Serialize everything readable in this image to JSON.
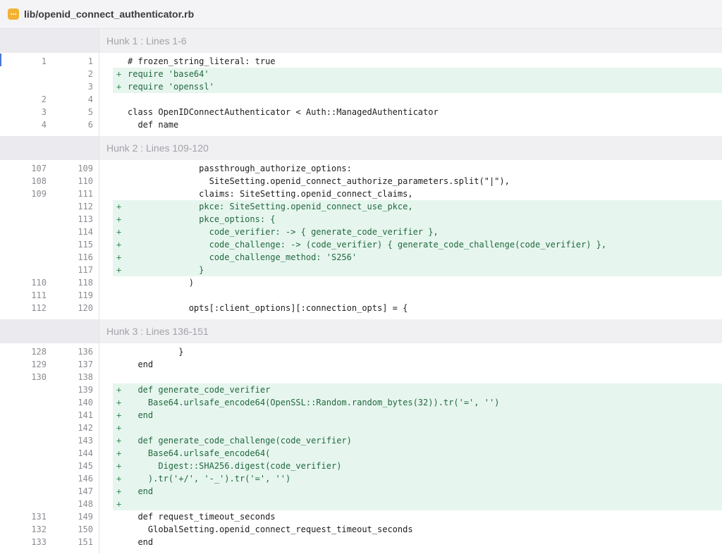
{
  "file": {
    "path": "lib/openid_connect_authenticator.rb",
    "icon": "file-ellipsis-icon"
  },
  "hunks": [
    {
      "label": "Hunk 1 : Lines 1-6",
      "lines": [
        {
          "old": "1",
          "new": "1",
          "type": "context",
          "sign": "",
          "code": "# frozen_string_literal: true"
        },
        {
          "old": "",
          "new": "2",
          "type": "added",
          "sign": "+",
          "code": "require 'base64'"
        },
        {
          "old": "",
          "new": "3",
          "type": "added",
          "sign": "+",
          "code": "require 'openssl'"
        },
        {
          "old": "2",
          "new": "4",
          "type": "context",
          "sign": "",
          "code": ""
        },
        {
          "old": "3",
          "new": "5",
          "type": "context",
          "sign": "",
          "code": "class OpenIDConnectAuthenticator < Auth::ManagedAuthenticator"
        },
        {
          "old": "4",
          "new": "6",
          "type": "context",
          "sign": "",
          "code": "  def name"
        }
      ]
    },
    {
      "label": "Hunk 2 : Lines 109-120",
      "lines": [
        {
          "old": "107",
          "new": "109",
          "type": "context",
          "sign": "",
          "code": "              passthrough_authorize_options:"
        },
        {
          "old": "108",
          "new": "110",
          "type": "context",
          "sign": "",
          "code": "                SiteSetting.openid_connect_authorize_parameters.split(\"|\"),"
        },
        {
          "old": "109",
          "new": "111",
          "type": "context",
          "sign": "",
          "code": "              claims: SiteSetting.openid_connect_claims,"
        },
        {
          "old": "",
          "new": "112",
          "type": "added",
          "sign": "+",
          "code": "              pkce: SiteSetting.openid_connect_use_pkce,"
        },
        {
          "old": "",
          "new": "113",
          "type": "added",
          "sign": "+",
          "code": "              pkce_options: {"
        },
        {
          "old": "",
          "new": "114",
          "type": "added",
          "sign": "+",
          "code": "                code_verifier: -> { generate_code_verifier },"
        },
        {
          "old": "",
          "new": "115",
          "type": "added",
          "sign": "+",
          "code": "                code_challenge: -> (code_verifier) { generate_code_challenge(code_verifier) },"
        },
        {
          "old": "",
          "new": "116",
          "type": "added",
          "sign": "+",
          "code": "                code_challenge_method: 'S256'"
        },
        {
          "old": "",
          "new": "117",
          "type": "added",
          "sign": "+",
          "code": "              }"
        },
        {
          "old": "110",
          "new": "118",
          "type": "context",
          "sign": "",
          "code": "            )"
        },
        {
          "old": "111",
          "new": "119",
          "type": "context",
          "sign": "",
          "code": ""
        },
        {
          "old": "112",
          "new": "120",
          "type": "context",
          "sign": "",
          "code": "            opts[:client_options][:connection_opts] = {"
        }
      ]
    },
    {
      "label": "Hunk 3 : Lines 136-151",
      "lines": [
        {
          "old": "128",
          "new": "136",
          "type": "context",
          "sign": "",
          "code": "          }"
        },
        {
          "old": "129",
          "new": "137",
          "type": "context",
          "sign": "",
          "code": "  end"
        },
        {
          "old": "130",
          "new": "138",
          "type": "context",
          "sign": "",
          "code": ""
        },
        {
          "old": "",
          "new": "139",
          "type": "added",
          "sign": "+",
          "code": "  def generate_code_verifier"
        },
        {
          "old": "",
          "new": "140",
          "type": "added",
          "sign": "+",
          "code": "    Base64.urlsafe_encode64(OpenSSL::Random.random_bytes(32)).tr('=', '')"
        },
        {
          "old": "",
          "new": "141",
          "type": "added",
          "sign": "+",
          "code": "  end"
        },
        {
          "old": "",
          "new": "142",
          "type": "added",
          "sign": "+",
          "code": ""
        },
        {
          "old": "",
          "new": "143",
          "type": "added",
          "sign": "+",
          "code": "  def generate_code_challenge(code_verifier)"
        },
        {
          "old": "",
          "new": "144",
          "type": "added",
          "sign": "+",
          "code": "    Base64.urlsafe_encode64("
        },
        {
          "old": "",
          "new": "145",
          "type": "added",
          "sign": "+",
          "code": "      Digest::SHA256.digest(code_verifier)"
        },
        {
          "old": "",
          "new": "146",
          "type": "added",
          "sign": "+",
          "code": "    ).tr('+/', '-_').tr('=', '')"
        },
        {
          "old": "",
          "new": "147",
          "type": "added",
          "sign": "+",
          "code": "  end"
        },
        {
          "old": "",
          "new": "148",
          "type": "added",
          "sign": "+",
          "code": ""
        },
        {
          "old": "131",
          "new": "149",
          "type": "context",
          "sign": "",
          "code": "  def request_timeout_seconds"
        },
        {
          "old": "132",
          "new": "150",
          "type": "context",
          "sign": "",
          "code": "    GlobalSetting.openid_connect_request_timeout_seconds"
        },
        {
          "old": "133",
          "new": "151",
          "type": "context",
          "sign": "",
          "code": "  end"
        }
      ]
    }
  ],
  "colors": {
    "added_bg": "#e6f6ee",
    "added_text": "#22683f",
    "hunk_bg": "#f0f0f3",
    "file_icon": "#f2b233"
  }
}
